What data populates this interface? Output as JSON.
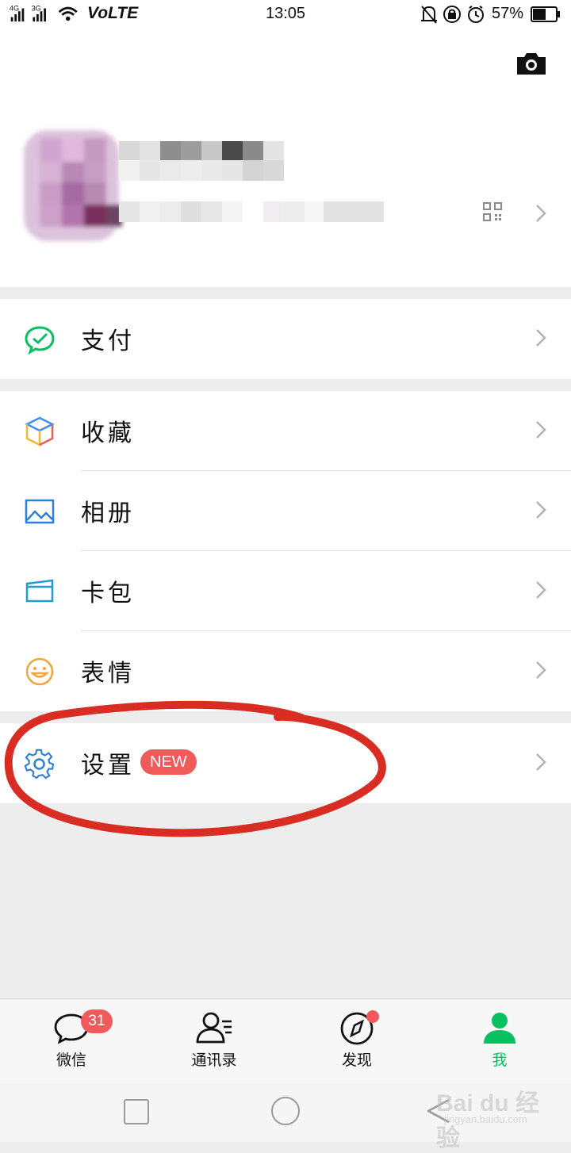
{
  "status_bar": {
    "network_left": "4G",
    "network_right": "3G",
    "volte": "VoLTE",
    "time": "13:05",
    "battery_percent": "57%",
    "battery_level": 0.57,
    "icons": [
      "signal-icon",
      "wifi-icon",
      "bell-muted-icon",
      "rotation-lock-icon",
      "alarm-icon",
      "battery-icon"
    ]
  },
  "profile": {
    "camera_icon": "camera-icon",
    "qr_icon": "qr-code-icon"
  },
  "menu": {
    "pay": {
      "label": "支付",
      "icon": "wechat-pay-icon"
    },
    "favorites": {
      "label": "收藏",
      "icon": "cube-icon"
    },
    "album": {
      "label": "相册",
      "icon": "photo-icon"
    },
    "cards": {
      "label": "卡包",
      "icon": "card-wallet-icon"
    },
    "stickers": {
      "label": "表情",
      "icon": "smiley-icon"
    },
    "settings": {
      "label": "设置",
      "badge": "NEW",
      "icon": "gear-icon"
    }
  },
  "tabbar": {
    "tabs": [
      {
        "label": "微信",
        "badge": "31",
        "icon": "chat-bubble-icon",
        "active": false
      },
      {
        "label": "通讯录",
        "icon": "contacts-icon",
        "active": false
      },
      {
        "label": "发现",
        "icon": "compass-icon",
        "active": false
      },
      {
        "label": "我",
        "icon": "person-icon",
        "active": true
      }
    ]
  },
  "watermark": {
    "main": "Bai du 经验",
    "sub": "jingyan.baidu.com"
  },
  "colors": {
    "accent": "#07c160",
    "badge": "#f05a5a",
    "annotation": "#d92d24"
  }
}
